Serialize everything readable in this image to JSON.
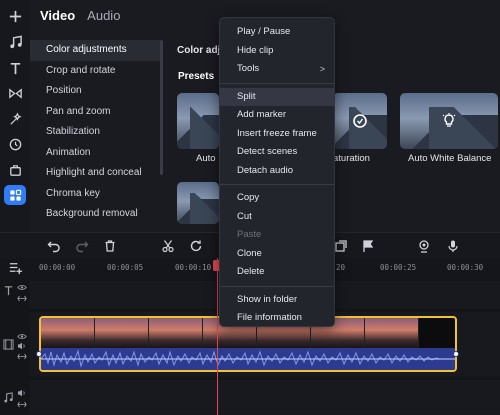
{
  "tabs": [
    {
      "label": "Video"
    },
    {
      "label": "Audio"
    }
  ],
  "categories": [
    "Color adjustments",
    "Crop and rotate",
    "Position",
    "Pan and zoom",
    "Stabilization",
    "Animation",
    "Highlight and conceal",
    "Chroma key",
    "Background removal"
  ],
  "section_title": "Color adj",
  "presets_label": "Presets",
  "presets": [
    {
      "label": "Auto",
      "icon": "none"
    },
    {
      "label": "aturation",
      "icon": "saturation-icon"
    },
    {
      "label": "Auto White Balance",
      "icon": "lightbulb-icon"
    }
  ],
  "context_menu": {
    "group1": [
      {
        "label": "Play / Pause"
      },
      {
        "label": "Hide clip"
      },
      {
        "label": "Tools",
        "submenu": true,
        "arrow": ">"
      }
    ],
    "group2": [
      {
        "label": "Split",
        "highlighted": true
      },
      {
        "label": "Add marker"
      },
      {
        "label": "Insert freeze frame"
      },
      {
        "label": "Detect scenes"
      },
      {
        "label": "Detach audio"
      }
    ],
    "group3": [
      {
        "label": "Copy"
      },
      {
        "label": "Cut"
      },
      {
        "label": "Paste",
        "disabled": true
      },
      {
        "label": "Clone"
      },
      {
        "label": "Delete"
      }
    ],
    "group4": [
      {
        "label": "Show in folder"
      },
      {
        "label": "File information"
      }
    ]
  },
  "ruler": {
    "labels": [
      "00:00:00",
      "00:00:05",
      "00:00:10",
      "20",
      "00:00:25",
      "00:00:30"
    ]
  },
  "colors": {
    "accent": "#2f7cf6",
    "clip_border": "#f2c230",
    "playhead": "#e1474f",
    "audio_wave": "#2c3b8f"
  }
}
